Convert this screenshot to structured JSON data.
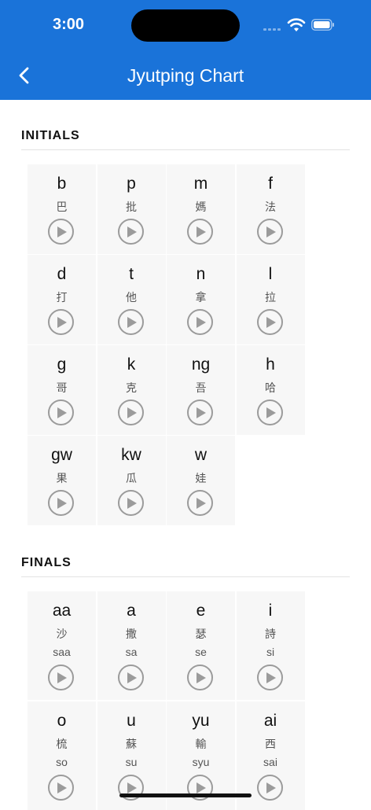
{
  "status": {
    "time": "3:00"
  },
  "nav": {
    "title": "Jyutping Chart"
  },
  "initials": {
    "title": "INITIALS",
    "items": [
      {
        "sym": "b",
        "chr": "巴"
      },
      {
        "sym": "p",
        "chr": "批"
      },
      {
        "sym": "m",
        "chr": "媽"
      },
      {
        "sym": "f",
        "chr": "法"
      },
      {
        "sym": "d",
        "chr": "打"
      },
      {
        "sym": "t",
        "chr": "他"
      },
      {
        "sym": "n",
        "chr": "拿"
      },
      {
        "sym": "l",
        "chr": "拉"
      },
      {
        "sym": "g",
        "chr": "哥"
      },
      {
        "sym": "k",
        "chr": "克"
      },
      {
        "sym": "ng",
        "chr": "吾"
      },
      {
        "sym": "h",
        "chr": "哈"
      },
      {
        "sym": "gw",
        "chr": "果"
      },
      {
        "sym": "kw",
        "chr": "瓜"
      },
      {
        "sym": "w",
        "chr": "娃"
      }
    ]
  },
  "finals": {
    "title": "FINALS",
    "items": [
      {
        "sym": "aa",
        "chr": "沙",
        "rom": "saa"
      },
      {
        "sym": "a",
        "chr": "撒",
        "rom": "sa"
      },
      {
        "sym": "e",
        "chr": "瑟",
        "rom": "se"
      },
      {
        "sym": "i",
        "chr": "詩",
        "rom": "si"
      },
      {
        "sym": "o",
        "chr": "梳",
        "rom": "so"
      },
      {
        "sym": "u",
        "chr": "蘇",
        "rom": "su"
      },
      {
        "sym": "yu",
        "chr": "輸",
        "rom": "syu"
      },
      {
        "sym": "ai",
        "chr": "西",
        "rom": "sai"
      }
    ]
  },
  "colors": {
    "header": "#1a73d9",
    "cell": "#f7f7f7",
    "playRing": "#9b9b9b"
  },
  "icons": {
    "back": "chevron-left-icon",
    "play": "play-icon"
  }
}
